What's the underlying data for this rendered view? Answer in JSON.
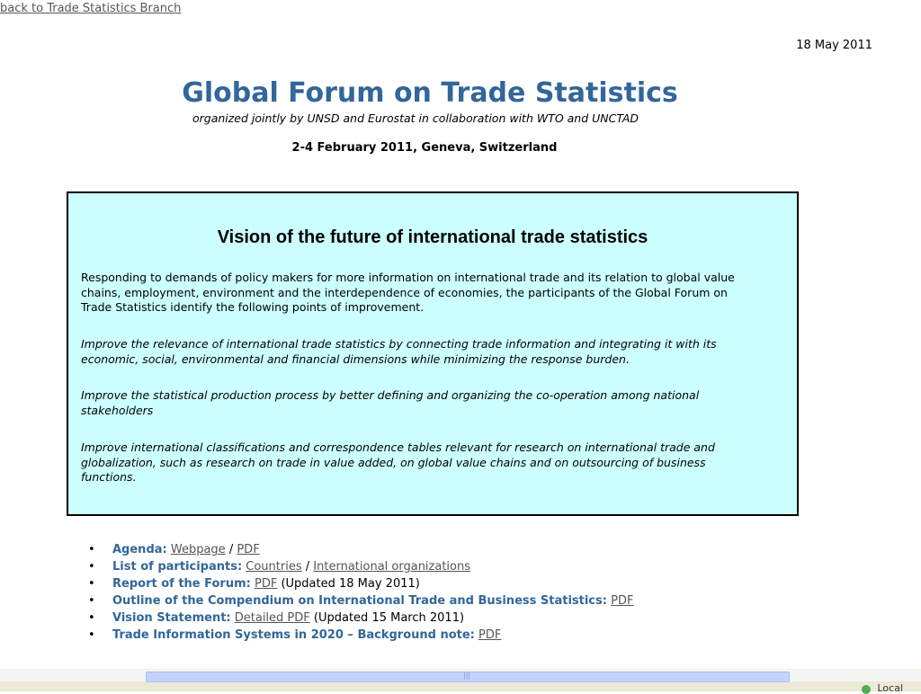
{
  "nav": {
    "back_link": "back to Trade Statistics Branch"
  },
  "header": {
    "date": "18 May 2011",
    "title": "Global Forum on Trade Statistics",
    "subtitle": "organized jointly by UNSD and Eurostat in collaboration with WTO and UNCTAD",
    "event": "2-4 February 2011, Geneva, Switzerland"
  },
  "vision_box": {
    "heading": "Vision of the future of international trade statistics",
    "intro": "Responding to demands of policy makers for more information on international trade and its relation to global value chains, employment, environment and the interdependence of economies, the participants of the Global Forum on Trade Statistics identify the following points of improvement.",
    "points": [
      "Improve the relevance of international trade statistics by connecting trade information and integrating it with its economic, social, environmental and financial dimensions while minimizing the response burden.",
      "Improve the statistical production process by better defining and organizing the co-operation among national stakeholders",
      "Improve international classifications and correspondence tables relevant for research on international trade and globalization, such as research on trade in value added, on global value chains and on outsourcing of business functions."
    ]
  },
  "links": [
    {
      "label": "Agenda:",
      "link1": "Webpage",
      "sep": "/",
      "link2": "PDF"
    },
    {
      "label": "List of participants:",
      "link1": "Countries",
      "sep": "/",
      "link2": "International organizations"
    },
    {
      "label": "Report of the Forum:",
      "link1": "PDF",
      "note": "(Updated 18 May 2011)"
    },
    {
      "label": "Outline of the Compendium on International Trade and Business Statistics:",
      "link1": "PDF"
    },
    {
      "label": "Vision Statement:",
      "link1": "Detailed PDF",
      "note": "(Updated 15 March 2011)"
    },
    {
      "label": "Trade Information Systems in 2020 – Background note:",
      "link1": "PDF"
    }
  ],
  "statusbar": {
    "text": "Local"
  }
}
